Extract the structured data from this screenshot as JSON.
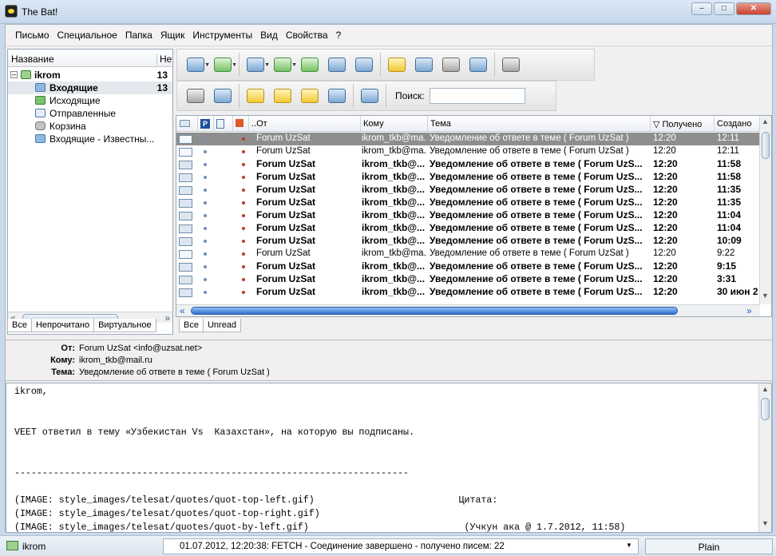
{
  "window": {
    "title": "The Bat!",
    "controls": [
      "–",
      "□",
      "✕"
    ]
  },
  "menu": [
    "Письмо",
    "Специальное",
    "Папка",
    "Ящик",
    "Инструменты",
    "Вид",
    "Свойства",
    "?"
  ],
  "folders": {
    "headers": {
      "name": "Название",
      "count": "Неп"
    },
    "account": {
      "name": "ikrom",
      "count": "13"
    },
    "items": [
      {
        "label": "Входящие",
        "count": "13",
        "bold": true
      },
      {
        "label": "Исходящие",
        "count": ""
      },
      {
        "label": "Отправленные",
        "count": ""
      },
      {
        "label": "Корзина",
        "count": ""
      },
      {
        "label": "Входящие - Известны...",
        "count": ""
      }
    ],
    "tabs": [
      "Все",
      "Непрочитано",
      "Виртуальное"
    ]
  },
  "toolbar": {
    "search_label": "Поиск:",
    "search_value": "",
    "row1": [
      {
        "icon": "get-mail-icon",
        "color": "blue",
        "dropdown": true
      },
      {
        "icon": "send-queue-icon",
        "color": "green",
        "dropdown": true
      },
      {
        "icon": "new-message-icon",
        "color": "blue",
        "dropdown": true
      },
      {
        "icon": "reply-icon",
        "color": "green",
        "dropdown": true
      },
      {
        "icon": "reply-all-icon",
        "color": "green",
        "dropdown": false
      },
      {
        "icon": "forward-icon",
        "color": "blue",
        "dropdown": false
      },
      {
        "icon": "redirect-icon",
        "color": "blue",
        "dropdown": false
      },
      {
        "icon": "address-book-icon",
        "color": "yellow",
        "dropdown": false
      },
      {
        "icon": "find-icon",
        "color": "blue",
        "dropdown": false
      },
      {
        "icon": "print-icon",
        "color": "gray",
        "dropdown": false
      },
      {
        "icon": "save-icon",
        "color": "blue",
        "dropdown": false
      },
      {
        "icon": "delete-icon",
        "color": "gray",
        "dropdown": false
      }
    ],
    "row2": [
      {
        "icon": "message-template-icon",
        "color": "gray"
      },
      {
        "icon": "scheduler-icon",
        "color": "blue"
      },
      {
        "icon": "folder-lock-icon",
        "color": "yellow"
      },
      {
        "icon": "new-folder-icon",
        "color": "yellow"
      },
      {
        "icon": "folder-properties-icon",
        "color": "yellow"
      },
      {
        "icon": "filters-icon",
        "color": "blue"
      },
      {
        "icon": "settings-icon",
        "color": "blue"
      }
    ]
  },
  "message_list": {
    "columns": [
      "От",
      "Кому",
      "Тема",
      "Получено",
      "Создано"
    ],
    "rows": [
      {
        "from": "Forum UzSat",
        "to": "ikrom_tkb@ma...",
        "subject": "Уведомление об ответе в теме ( Forum UzSat )",
        "received": "12:20",
        "created": "12:11",
        "unread": false,
        "selected": true
      },
      {
        "from": "Forum UzSat",
        "to": "ikrom_tkb@ma...",
        "subject": "Уведомление об ответе в теме ( Forum UzSat )",
        "received": "12:20",
        "created": "12:11",
        "unread": false
      },
      {
        "from": "Forum UzSat",
        "to": "ikrom_tkb@...",
        "subject": "Уведомление об ответе в теме ( Forum UzS...",
        "received": "12:20",
        "created": "11:58",
        "unread": true
      },
      {
        "from": "Forum UzSat",
        "to": "ikrom_tkb@...",
        "subject": "Уведомление об ответе в теме ( Forum UzS...",
        "received": "12:20",
        "created": "11:58",
        "unread": true
      },
      {
        "from": "Forum UzSat",
        "to": "ikrom_tkb@...",
        "subject": "Уведомление об ответе в теме ( Forum UzS...",
        "received": "12:20",
        "created": "11:35",
        "unread": true
      },
      {
        "from": "Forum UzSat",
        "to": "ikrom_tkb@...",
        "subject": "Уведомление об ответе в теме ( Forum UzS...",
        "received": "12:20",
        "created": "11:35",
        "unread": true
      },
      {
        "from": "Forum UzSat",
        "to": "ikrom_tkb@...",
        "subject": "Уведомление об ответе в теме ( Forum UzS...",
        "received": "12:20",
        "created": "11:04",
        "unread": true
      },
      {
        "from": "Forum UzSat",
        "to": "ikrom_tkb@...",
        "subject": "Уведомление об ответе в теме ( Forum UzS...",
        "received": "12:20",
        "created": "11:04",
        "unread": true
      },
      {
        "from": "Forum UzSat",
        "to": "ikrom_tkb@...",
        "subject": "Уведомление об ответе в теме ( Forum UzS...",
        "received": "12:20",
        "created": "10:09",
        "unread": true
      },
      {
        "from": "Forum UzSat",
        "to": "ikrom_tkb@ma...",
        "subject": "Уведомление об ответе в теме ( Forum UzSat )",
        "received": "12:20",
        "created": "9:22",
        "unread": false
      },
      {
        "from": "Forum UzSat",
        "to": "ikrom_tkb@...",
        "subject": "Уведомление об ответе в теме ( Forum UzS...",
        "received": "12:20",
        "created": "9:15",
        "unread": true
      },
      {
        "from": "Forum UzSat",
        "to": "ikrom_tkb@...",
        "subject": "Уведомление об ответе в теме ( Forum UzS...",
        "received": "12:20",
        "created": "3:31",
        "unread": true
      },
      {
        "from": "Forum UzSat",
        "to": "ikrom_tkb@...",
        "subject": "Уведомление об ответе в теме ( Forum UzS...",
        "received": "12:20",
        "created": "30 июн 2",
        "unread": true
      }
    ],
    "tabs": [
      "Все",
      "Unread"
    ]
  },
  "message_header": {
    "from_label": "От:",
    "from": "Forum UzSat <info@uzsat.net>",
    "to_label": "Кому:",
    "to": "ikrom_tkb@mail.ru",
    "subject_label": "Тема:",
    "subject": "Уведомление об ответе в теме ( Forum UzSat )"
  },
  "message_body": {
    "lines": [
      "ikrom,",
      "",
      "",
      "VEET ответил в тему «Узбекистан Vs  Казахстан», на которую вы подписаны.",
      "",
      "",
      "-----------------------------------------------------------------------",
      "",
      "(IMAGE: style_images/telesat/quotes/quot-top-left.gif)                          Цитата:",
      "(IMAGE: style_images/telesat/quotes/quot-top-right.gif)",
      "(IMAGE: style_images/telesat/quotes/quot-by-left.gif)                            (Учкун ака @ 1.7.2012, 11:58)"
    ]
  },
  "status": {
    "account": "ikrom",
    "log": "01.07.2012, 12:20:38: FETCH - Соединение завершено - получено писем: 22",
    "mode": "Plain"
  },
  "colors": {
    "selected_row": "#8e8e8e",
    "accent": "#2d6fd0",
    "unread_dot": "#c0392b"
  }
}
